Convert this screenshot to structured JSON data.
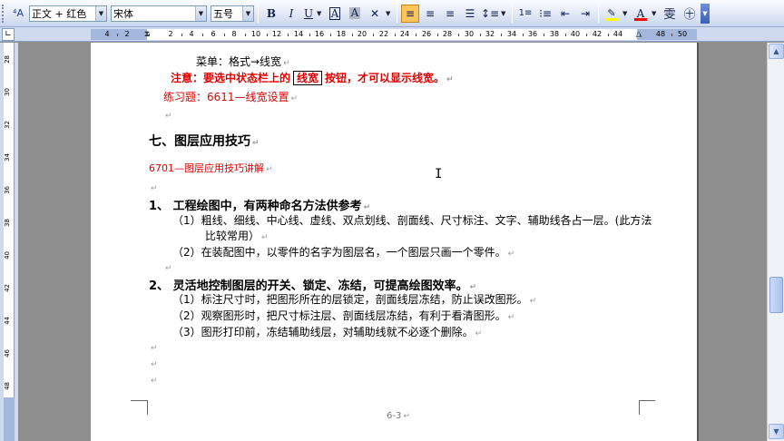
{
  "toolbar": {
    "style_value": "正文 + 红色",
    "font_value": "宋体",
    "size_value": "五号",
    "bold_label": "B",
    "italic_label": "I",
    "underline_label": "U",
    "char_border_label": "A",
    "char_shading_label": "A",
    "highlight_color": "#ffff00",
    "font_color": "#ff0000",
    "icons": [
      "styles-icon",
      "bold-icon",
      "italic-icon",
      "underline-icon",
      "char-border-icon",
      "char-shading-icon",
      "char-scale-icon",
      "align-left-icon",
      "align-center-icon",
      "align-right-icon",
      "justify-icon",
      "line-spacing-icon",
      "numbering-icon",
      "bullets-icon",
      "decrease-indent-icon",
      "increase-indent-icon",
      "highlight-icon",
      "font-color-icon",
      "phonetic-icon",
      "enclose-char-icon"
    ]
  },
  "ruler": {
    "numbers": [
      "4",
      "2",
      "2",
      "4",
      "6",
      "8",
      "10",
      "12",
      "14",
      "16",
      "18",
      "20",
      "22",
      "24",
      "26",
      "28",
      "30",
      "32",
      "34",
      "36",
      "38",
      "40",
      "42",
      "44",
      "48",
      "50"
    ]
  },
  "vruler": {
    "numbers": [
      "28",
      "30",
      "32",
      "34",
      "36",
      "38",
      "40",
      "42",
      "44",
      "46",
      "48"
    ]
  },
  "document": {
    "line1": "菜单：格式→线宽",
    "line2_a": "注意：要选中状态栏上的",
    "line2_box": "线宽",
    "line2_b": "按钮，才可以显示线宽。",
    "line3": "练习题：6611—线宽设置",
    "section_heading": "七、图层应用技巧",
    "section_link": "6701—图层应用技巧讲解",
    "item1_title": "1、 工程绘图中，有两种命名方法供参考",
    "item1_sub1": "（1）粗线、细线、中心线、虚线、双点划线、剖面线、尺寸标注、文字、辅助线各占一层。(此方法",
    "item1_sub1_cont": "比较常用）",
    "item1_sub2": "（2）在装配图中，以零件的名字为图层名，一个图层只画一个零件。",
    "item2_title": "2、 灵活地控制图层的开关、锁定、冻结，可提高绘图效率。",
    "item2_sub1": "（1）标注尺寸时，把图形所在的层锁定，剖面线层冻结，防止误改图形。",
    "item2_sub2": "（2）观察图形时，把尺寸标注层、剖面线层冻结，有利于看清图形。",
    "item2_sub3": "（3）图形打印前，冻结辅助线层，对辅助线就不必逐个删除。",
    "page_number": "6-3",
    "paragraph_mark": "↵"
  }
}
